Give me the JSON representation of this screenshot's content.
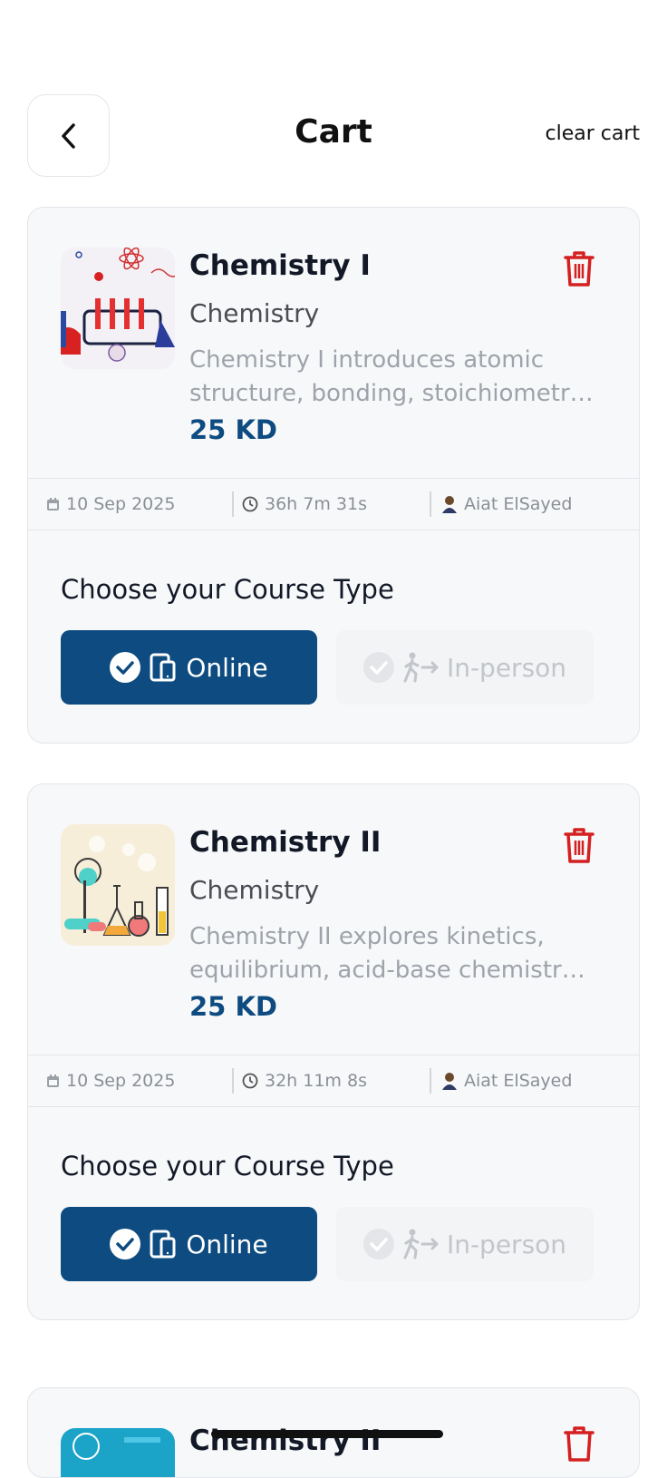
{
  "header": {
    "title": "Cart",
    "clear_label": "clear cart"
  },
  "courses": [
    {
      "title": "Chemistry I",
      "subject": "Chemistry",
      "description": "Chemistry I introduces atomic structure, bonding, stoichiometry and the foundations of chemical reactions.",
      "price": "25 KD",
      "date": "10 Sep 2025",
      "duration": "36h 7m 31s",
      "instructor": "Aiat ElSayed",
      "choose_label": "Choose your Course Type",
      "online_label": "Online",
      "inperson_label": "In-person"
    },
    {
      "title": "Chemistry II",
      "subject": "Chemistry",
      "description": "Chemistry II explores kinetics, equilibrium, acid-base chemistry and thermodynamics.",
      "price": "25 KD",
      "date": "10 Sep 2025",
      "duration": "32h 11m 8s",
      "instructor": "Aiat ElSayed",
      "choose_label": "Choose your Course Type",
      "online_label": "Online",
      "inperson_label": "In-person"
    },
    {
      "title": "Chemistry II"
    }
  ],
  "colors": {
    "accent": "#0d4b80",
    "danger": "#d42020",
    "muted": "#9ea3aa"
  }
}
